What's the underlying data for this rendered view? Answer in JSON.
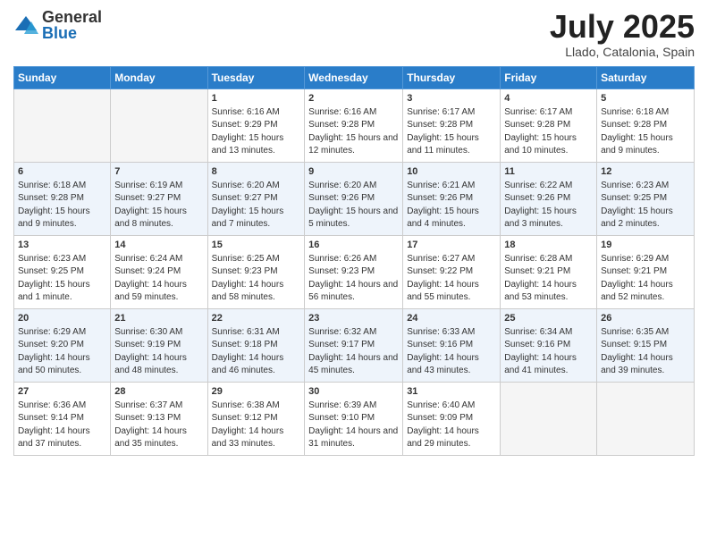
{
  "logo": {
    "general": "General",
    "blue": "Blue"
  },
  "title": "July 2025",
  "location": "Llado, Catalonia, Spain",
  "days_of_week": [
    "Sunday",
    "Monday",
    "Tuesday",
    "Wednesday",
    "Thursday",
    "Friday",
    "Saturday"
  ],
  "weeks": [
    [
      {
        "day": "",
        "info": ""
      },
      {
        "day": "",
        "info": ""
      },
      {
        "day": "1",
        "info": "Sunrise: 6:16 AM\nSunset: 9:29 PM\nDaylight: 15 hours and 13 minutes."
      },
      {
        "day": "2",
        "info": "Sunrise: 6:16 AM\nSunset: 9:28 PM\nDaylight: 15 hours and 12 minutes."
      },
      {
        "day": "3",
        "info": "Sunrise: 6:17 AM\nSunset: 9:28 PM\nDaylight: 15 hours and 11 minutes."
      },
      {
        "day": "4",
        "info": "Sunrise: 6:17 AM\nSunset: 9:28 PM\nDaylight: 15 hours and 10 minutes."
      },
      {
        "day": "5",
        "info": "Sunrise: 6:18 AM\nSunset: 9:28 PM\nDaylight: 15 hours and 9 minutes."
      }
    ],
    [
      {
        "day": "6",
        "info": "Sunrise: 6:18 AM\nSunset: 9:28 PM\nDaylight: 15 hours and 9 minutes."
      },
      {
        "day": "7",
        "info": "Sunrise: 6:19 AM\nSunset: 9:27 PM\nDaylight: 15 hours and 8 minutes."
      },
      {
        "day": "8",
        "info": "Sunrise: 6:20 AM\nSunset: 9:27 PM\nDaylight: 15 hours and 7 minutes."
      },
      {
        "day": "9",
        "info": "Sunrise: 6:20 AM\nSunset: 9:26 PM\nDaylight: 15 hours and 5 minutes."
      },
      {
        "day": "10",
        "info": "Sunrise: 6:21 AM\nSunset: 9:26 PM\nDaylight: 15 hours and 4 minutes."
      },
      {
        "day": "11",
        "info": "Sunrise: 6:22 AM\nSunset: 9:26 PM\nDaylight: 15 hours and 3 minutes."
      },
      {
        "day": "12",
        "info": "Sunrise: 6:23 AM\nSunset: 9:25 PM\nDaylight: 15 hours and 2 minutes."
      }
    ],
    [
      {
        "day": "13",
        "info": "Sunrise: 6:23 AM\nSunset: 9:25 PM\nDaylight: 15 hours and 1 minute."
      },
      {
        "day": "14",
        "info": "Sunrise: 6:24 AM\nSunset: 9:24 PM\nDaylight: 14 hours and 59 minutes."
      },
      {
        "day": "15",
        "info": "Sunrise: 6:25 AM\nSunset: 9:23 PM\nDaylight: 14 hours and 58 minutes."
      },
      {
        "day": "16",
        "info": "Sunrise: 6:26 AM\nSunset: 9:23 PM\nDaylight: 14 hours and 56 minutes."
      },
      {
        "day": "17",
        "info": "Sunrise: 6:27 AM\nSunset: 9:22 PM\nDaylight: 14 hours and 55 minutes."
      },
      {
        "day": "18",
        "info": "Sunrise: 6:28 AM\nSunset: 9:21 PM\nDaylight: 14 hours and 53 minutes."
      },
      {
        "day": "19",
        "info": "Sunrise: 6:29 AM\nSunset: 9:21 PM\nDaylight: 14 hours and 52 minutes."
      }
    ],
    [
      {
        "day": "20",
        "info": "Sunrise: 6:29 AM\nSunset: 9:20 PM\nDaylight: 14 hours and 50 minutes."
      },
      {
        "day": "21",
        "info": "Sunrise: 6:30 AM\nSunset: 9:19 PM\nDaylight: 14 hours and 48 minutes."
      },
      {
        "day": "22",
        "info": "Sunrise: 6:31 AM\nSunset: 9:18 PM\nDaylight: 14 hours and 46 minutes."
      },
      {
        "day": "23",
        "info": "Sunrise: 6:32 AM\nSunset: 9:17 PM\nDaylight: 14 hours and 45 minutes."
      },
      {
        "day": "24",
        "info": "Sunrise: 6:33 AM\nSunset: 9:16 PM\nDaylight: 14 hours and 43 minutes."
      },
      {
        "day": "25",
        "info": "Sunrise: 6:34 AM\nSunset: 9:16 PM\nDaylight: 14 hours and 41 minutes."
      },
      {
        "day": "26",
        "info": "Sunrise: 6:35 AM\nSunset: 9:15 PM\nDaylight: 14 hours and 39 minutes."
      }
    ],
    [
      {
        "day": "27",
        "info": "Sunrise: 6:36 AM\nSunset: 9:14 PM\nDaylight: 14 hours and 37 minutes."
      },
      {
        "day": "28",
        "info": "Sunrise: 6:37 AM\nSunset: 9:13 PM\nDaylight: 14 hours and 35 minutes."
      },
      {
        "day": "29",
        "info": "Sunrise: 6:38 AM\nSunset: 9:12 PM\nDaylight: 14 hours and 33 minutes."
      },
      {
        "day": "30",
        "info": "Sunrise: 6:39 AM\nSunset: 9:10 PM\nDaylight: 14 hours and 31 minutes."
      },
      {
        "day": "31",
        "info": "Sunrise: 6:40 AM\nSunset: 9:09 PM\nDaylight: 14 hours and 29 minutes."
      },
      {
        "day": "",
        "info": ""
      },
      {
        "day": "",
        "info": ""
      }
    ]
  ]
}
